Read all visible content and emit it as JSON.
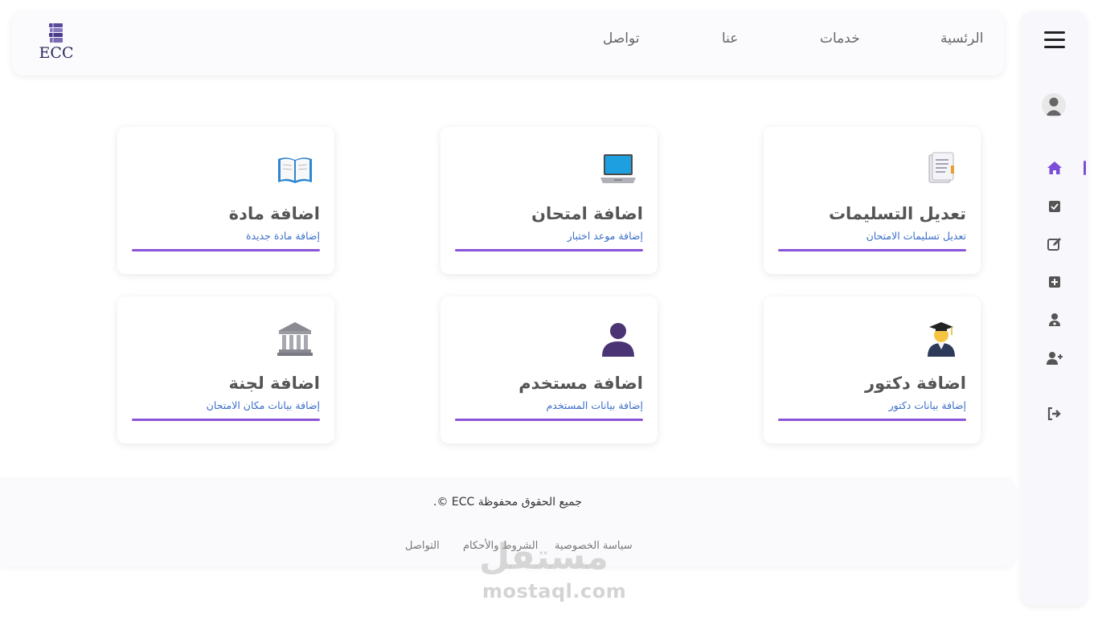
{
  "navbar": {
    "logo_text": "ECC",
    "links": [
      "الرئسية",
      "خدمات",
      "عنا",
      "تواصل"
    ]
  },
  "cards": [
    {
      "title": "تعديل التسليمات",
      "subtitle": "تعديل تسليمات الامتحان",
      "icon": "document-icon"
    },
    {
      "title": "اضافة امتحان",
      "subtitle": "إضافة موعد اختبار",
      "icon": "laptop-icon"
    },
    {
      "title": "اضافة مادة",
      "subtitle": "إضافة مادة جديدة",
      "icon": "book-icon"
    },
    {
      "title": "اضافة دكتور",
      "subtitle": "إضافة بيانات دكتور",
      "icon": "graduate-icon"
    },
    {
      "title": "اضافة مستخدم",
      "subtitle": "إضافة بيانات المستخدم",
      "icon": "user-icon"
    },
    {
      "title": "اضافة لجنة",
      "subtitle": "إضافة بيانات مكان الامتحان",
      "icon": "building-icon"
    }
  ],
  "sidebar": {
    "icons": [
      "menu-icon",
      "avatar",
      "home-icon",
      "checkbox-icon",
      "edit-icon",
      "plus-square-icon",
      "user-doctor-icon",
      "user-plus-icon",
      "logout-icon"
    ]
  },
  "footer": {
    "copyright": "جميع الحقوق محفوظة ECC ©.",
    "links": [
      "سياسة الخصوصية",
      "الشروط والأحكام",
      "التواصل"
    ]
  },
  "watermark": {
    "arabic": "مستقل",
    "latin": "mostaql.com"
  },
  "colors": {
    "accent": "#8a55d6",
    "subtitle": "#3b6fc8",
    "sidebar_icon": "#555555",
    "active_icon": "#7c4dd8"
  }
}
